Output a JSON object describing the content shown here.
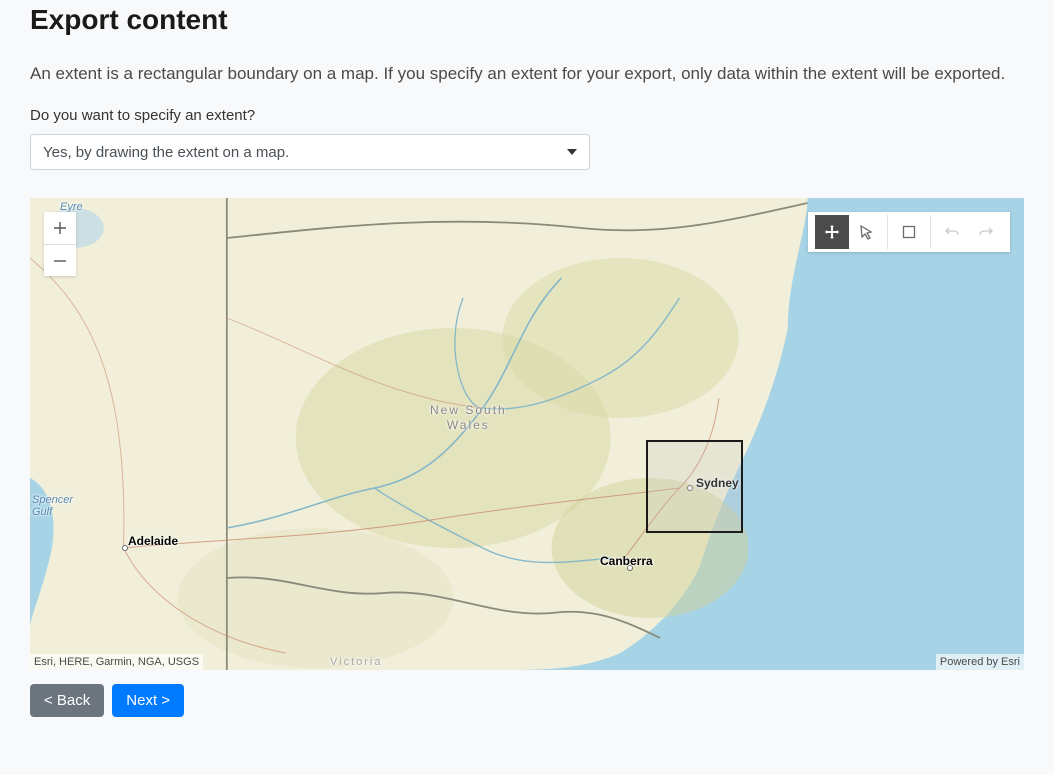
{
  "title": "Export content",
  "description": "An extent is a rectangular boundary on a map. If you specify an extent for your export, only data within the extent will be exported.",
  "question": "Do you want to specify an extent?",
  "select": {
    "selected": "Yes, by drawing the extent on a map."
  },
  "zoom": {
    "in": "+",
    "out": "−"
  },
  "attribution": {
    "left": "Esri, HERE, Garmin, NGA, USGS",
    "right": "Powered by Esri"
  },
  "buttons": {
    "back": "< Back",
    "next": "Next >"
  },
  "labels": {
    "nsw1": "New South",
    "nsw2": "Wales",
    "sydney": "Sydney",
    "canberra": "Canberra",
    "adelaide": "Adelaide",
    "victoria": "Victoria",
    "spencer1": "Spencer",
    "spencer2": "Gulf",
    "eyre": "Eyre"
  }
}
